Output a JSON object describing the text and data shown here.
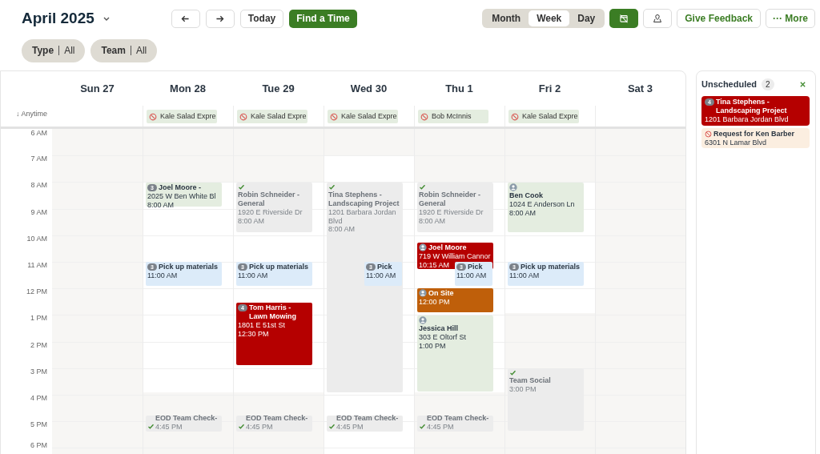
{
  "toolbar": {
    "title": "April 2025",
    "buttons": [
      {
        "kind": "prev"
      },
      {
        "kind": "next"
      },
      {
        "kind": "text",
        "label": "Today"
      },
      {
        "kind": "primary",
        "label": "Find a Time"
      }
    ],
    "views": [
      {
        "label": "Month",
        "selected": false
      },
      {
        "label": "Week",
        "selected": true
      },
      {
        "label": "Day",
        "selected": false
      }
    ],
    "actions": [
      {
        "kind": "calendar-toggle"
      },
      {
        "kind": "map"
      },
      {
        "kind": "feedback",
        "label": "Give Feedback"
      },
      {
        "kind": "more",
        "label": "··· More"
      }
    ]
  },
  "filters": [
    {
      "label": "Type",
      "value": "All"
    },
    {
      "label": "Team",
      "value": "All"
    }
  ],
  "anytime_label": "↓ Anytime",
  "hours": [
    "6 AM",
    "7 AM",
    "8 AM",
    "9 AM",
    "10 AM",
    "11 AM",
    "12 PM",
    "1 PM",
    "2 PM",
    "3 PM",
    "4 PM",
    "5 PM",
    "6 PM"
  ],
  "days": [
    {
      "label": "Sun 27"
    },
    {
      "label": "Mon 28",
      "anytime": [
        "Kale Salad Expre"
      ],
      "events": [
        {
          "kind": "job",
          "badge": "3",
          "title": "Joel Moore -",
          "lines": [
            "2025 W Ben White Bl",
            "8:00 AM"
          ]
        },
        {
          "kind": "task",
          "badge": "3",
          "title": "Pick up materials",
          "lines": [
            "11:00 AM"
          ]
        },
        {
          "kind": "done",
          "title": "EOD Team Check-",
          "lines": [
            "4:45 PM"
          ]
        }
      ]
    },
    {
      "label": "Tue 29",
      "anytime": [
        "Kale Salad Expre"
      ],
      "events": [
        {
          "kind": "done",
          "title": "Robin Schneider - General",
          "lines": [
            "1920 E Riverside Dr",
            "8:00 AM"
          ]
        },
        {
          "kind": "task",
          "badge": "3",
          "title": "Pick up materials",
          "lines": [
            "11:00 AM"
          ]
        },
        {
          "kind": "late",
          "badge": "4",
          "title": "Tom Harris - Lawn Mowing",
          "lines": [
            "1801 E 51st St",
            "12:30 PM"
          ]
        },
        {
          "kind": "done",
          "title": "EOD Team Check-",
          "lines": [
            "4:45 PM"
          ]
        }
      ]
    },
    {
      "label": "Wed 30",
      "anytime": [
        "Kale Salad Expre"
      ],
      "events": [
        {
          "kind": "done",
          "title": "Tina Stephens - Landscaping Project",
          "lines": [
            "1201 Barbara Jordan Blvd",
            "8:00 AM"
          ]
        },
        {
          "kind": "task",
          "badge": "3",
          "title": "Pick",
          "lines": [
            "11:00 AM"
          ]
        },
        {
          "kind": "done",
          "title": "EOD Team Check-",
          "lines": [
            "4:45 PM"
          ]
        }
      ]
    },
    {
      "label": "Thu 1",
      "anytime": [
        "Bob McInnis"
      ],
      "events": [
        {
          "kind": "done",
          "title": "Robin Schneider - General",
          "lines": [
            "1920 E Riverside Dr",
            "8:00 AM"
          ]
        },
        {
          "kind": "late",
          "avatar": true,
          "title": "Joel Moore",
          "lines": [
            "719 W William Cannor",
            "10:15 AM"
          ]
        },
        {
          "kind": "task",
          "badge": "3",
          "title": "Pick",
          "lines": [
            "11:00 AM"
          ]
        },
        {
          "kind": "onsite",
          "avatar": true,
          "title": "On Site",
          "lines": [
            "12:00 PM"
          ]
        },
        {
          "kind": "job",
          "avatar": true,
          "title": "Jessica Hill",
          "lines": [
            "303 E Oltorf St",
            "1:00 PM"
          ]
        },
        {
          "kind": "done",
          "title": "EOD Team Check-",
          "lines": [
            "4:45 PM"
          ]
        }
      ]
    },
    {
      "label": "Fri 2",
      "anytime": [
        "Kale Salad Expre"
      ],
      "events": [
        {
          "kind": "job",
          "avatar": true,
          "title": "Ben Cook",
          "lines": [
            "1024 E Anderson Ln",
            "8:00 AM"
          ]
        },
        {
          "kind": "task",
          "badge": "3",
          "title": "Pick up materials",
          "lines": [
            "11:00 AM"
          ]
        },
        {
          "kind": "done",
          "title": "Team Social",
          "lines": [
            "3:00 PM"
          ]
        }
      ]
    },
    {
      "label": "Sat 3"
    }
  ],
  "unscheduled": {
    "title": "Unscheduled",
    "count": "2",
    "items": [
      {
        "kind": "late",
        "badge": "4",
        "title": "Tina Stephens - Landscaping Project",
        "lines": [
          "1201 Barbara Jordan Blvd"
        ]
      },
      {
        "kind": "request",
        "title": "Request for Ken Barber",
        "lines": [
          "6301 N Lamar Blvd"
        ]
      }
    ]
  }
}
